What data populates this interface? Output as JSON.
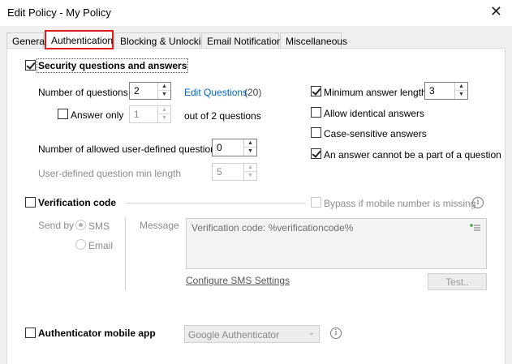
{
  "window": {
    "title": "Edit Policy - My Policy",
    "close_glyph": "✕"
  },
  "tabs": [
    "General",
    "Authentication",
    "Blocking & Unlocking",
    "Email Notifications",
    "Miscellaneous"
  ],
  "security": {
    "header": "Security questions and answers",
    "num_questions_label": "Number of questions",
    "num_questions_value": "2",
    "edit_questions_link": "Edit Questions",
    "edit_questions_count": "(20)",
    "answer_only_label": "Answer only",
    "answer_only_value": "1",
    "out_of_text": "out of 2 questions",
    "allowed_user_defined_label": "Number of allowed user-defined questions",
    "allowed_user_defined_value": "0",
    "user_defined_min_length_label": "User-defined question min length",
    "user_defined_min_length_value": "5",
    "min_answer_length_label": "Minimum answer length",
    "min_answer_length_value": "3",
    "allow_identical_label": "Allow identical answers",
    "case_sensitive_label": "Case-sensitive answers",
    "not_part_of_question_label": "An answer cannot be a part of a question"
  },
  "verification": {
    "header": "Verification code",
    "bypass_label": "Bypass if mobile number is missing",
    "send_by_label": "Send by",
    "sms_label": "SMS",
    "email_label": "Email",
    "message_label": "Message",
    "message_value": "Verification code: %verificationcode%",
    "configure_link": "Configure SMS Settings",
    "test_button": "Test..",
    "insert_icon": "insert-variable-icon"
  },
  "authenticator": {
    "header": "Authenticator mobile app",
    "selected": "Google Authenticator"
  },
  "info_glyph": "i"
}
